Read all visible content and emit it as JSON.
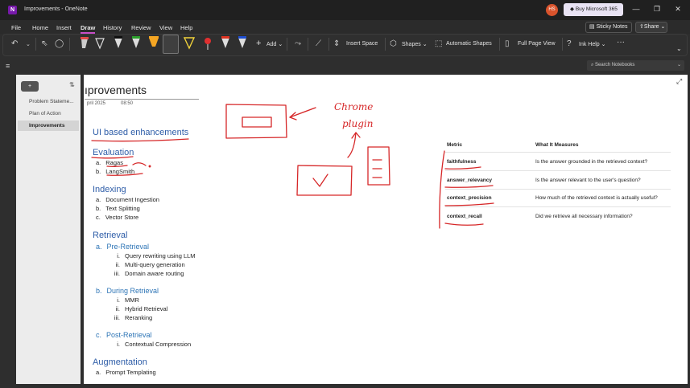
{
  "window": {
    "title": "Improvements - OneNote",
    "avatar_initials": "HS",
    "buy_label": "Buy Microsoft 365",
    "minimize": "—",
    "maximize": "❐",
    "close": "✕"
  },
  "menu": {
    "tabs": [
      "File",
      "Home",
      "Insert",
      "Draw",
      "History",
      "Review",
      "View",
      "Help"
    ],
    "active_tab": "Draw",
    "sticky_notes": "Sticky Notes",
    "share": "Share"
  },
  "ribbon": {
    "add_label": "Add",
    "insert_space": "Insert Space",
    "shapes": "Shapes",
    "automatic_shapes": "Automatic Shapes",
    "full_page_view": "Full Page View",
    "ink_help": "Ink Help",
    "more": "···"
  },
  "search": {
    "placeholder": "Search Notebooks"
  },
  "sidebar": {
    "new_page": "+",
    "pages": [
      {
        "label": "Problem Stateme..."
      },
      {
        "label": "Plan of Action"
      },
      {
        "label": "Improvements"
      }
    ],
    "active_page": "Improvements"
  },
  "page": {
    "title": "ıprovements",
    "date": "pril 2025",
    "time": "08:50",
    "ui_heading": "UI based enhancements",
    "evaluation": {
      "heading": "Evaluation",
      "items": [
        {
          "n": "a.",
          "t": "Ragas"
        },
        {
          "n": "b.",
          "t": "LangSmith"
        }
      ]
    },
    "indexing": {
      "heading": "Indexing",
      "items": [
        {
          "n": "a.",
          "t": "Document Ingestion"
        },
        {
          "n": "b.",
          "t": "Text Splitting"
        },
        {
          "n": "c.",
          "t": "Vector Store"
        }
      ]
    },
    "retrieval": {
      "heading": "Retrieval",
      "pre": {
        "n": "a.",
        "heading": "Pre-Retrieval",
        "items": [
          {
            "n": "i.",
            "t": "Query rewriting using LLM"
          },
          {
            "n": "ii.",
            "t": "Multi-query generation"
          },
          {
            "n": "iii.",
            "t": "Domain aware routing"
          }
        ]
      },
      "during": {
        "n": "b.",
        "heading": "During Retrieval",
        "items": [
          {
            "n": "i.",
            "t": "MMR"
          },
          {
            "n": "ii.",
            "t": "Hybrid Retrieval"
          },
          {
            "n": "iii.",
            "t": "Reranking"
          }
        ]
      },
      "post": {
        "n": "c.",
        "heading": "Post-Retrieval",
        "items": [
          {
            "n": "i.",
            "t": "Contextual Compression"
          }
        ]
      }
    },
    "augmentation": {
      "heading": "Augmentation",
      "items": [
        {
          "n": "a.",
          "t": "Prompt Templating"
        }
      ]
    },
    "handwriting": {
      "line1": "Chrome",
      "line2": "plugin"
    },
    "table": {
      "headers": [
        "Metric",
        "What It Measures"
      ],
      "rows": [
        {
          "metric": "faithfulness",
          "desc": "Is the answer grounded in the retrieved context?"
        },
        {
          "metric": "answer_relevancy",
          "desc": "Is the answer relevant to the user's question?"
        },
        {
          "metric": "context_precision",
          "desc": "How much of the retrieved context is actually useful?"
        },
        {
          "metric": "context_recall",
          "desc": "Did we retrieve all necessary information?"
        }
      ]
    }
  },
  "colors": {
    "ink_red": "#d62728",
    "heading_blue": "#2e5da8",
    "accent_purple": "#c84ec8"
  }
}
